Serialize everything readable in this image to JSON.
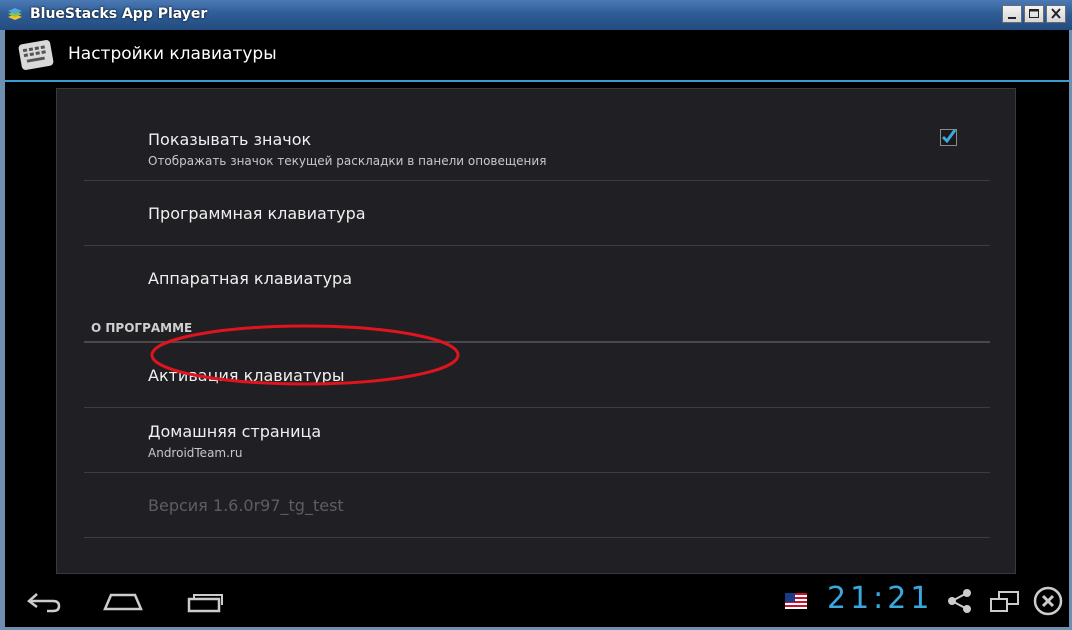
{
  "window": {
    "title": "BlueStacks App Player",
    "logo_icon": "bluestacks-logo-icon",
    "controls": [
      "minimize",
      "maximize",
      "close"
    ]
  },
  "actionbar": {
    "icon": "keyboard-icon",
    "title": "Настройки клавиатуры",
    "accent_color": "#3a9bd0"
  },
  "preferences": {
    "show_icon": {
      "title": "Показывать значок",
      "summary": "Отображать значок текущей раскладки в панели оповещения",
      "checked": true
    },
    "software_keyboard": {
      "title": "Программная клавиатура"
    },
    "hardware_keyboard": {
      "title": "Аппаратная клавиатура",
      "highlight": "red-ellipse"
    },
    "about_category": "О ПРОГРАММЕ",
    "activation": {
      "title": "Активация клавиатуры"
    },
    "homepage": {
      "title": "Домашняя страница",
      "summary": "AndroidTeam.ru"
    },
    "version": {
      "title": "Версия 1.6.0r97_tg_test",
      "enabled": false
    }
  },
  "systembar": {
    "clock": "21:21",
    "nav_icons": [
      "back-icon",
      "home-icon",
      "recent-apps-icon"
    ],
    "status_icons": [
      "us-flag-icon",
      "share-icon",
      "window-toggle-icon",
      "close-circle-icon"
    ],
    "clock_color": "#39a9e0"
  }
}
